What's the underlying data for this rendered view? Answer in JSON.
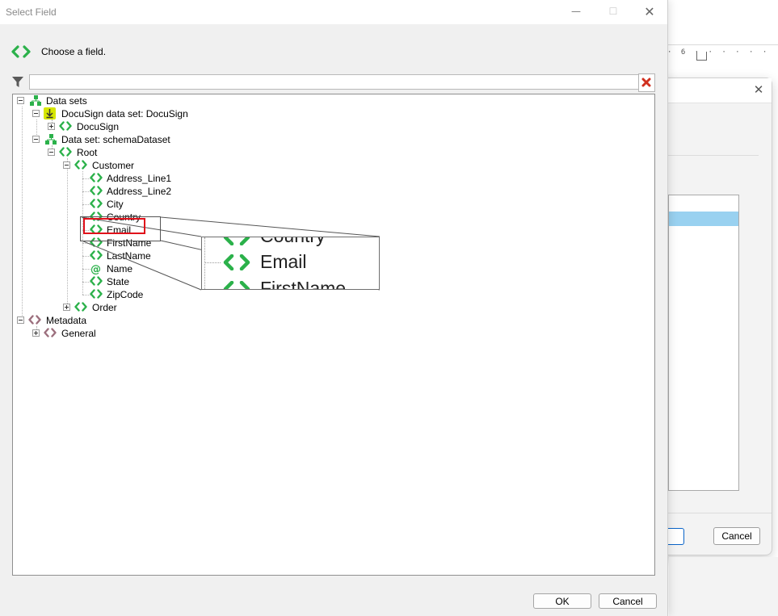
{
  "background": {
    "ruler_ticks": "· 6 ·  ·  ·  ·  ·  ·",
    "close_glyph": "✕",
    "cancel_label": "Cancel"
  },
  "dialog": {
    "title": "Select Field",
    "window_buttons": {
      "minimize": "—",
      "maximize": "☐",
      "close": "✕"
    },
    "prompt": "Choose a field.",
    "filter": {
      "value": "",
      "placeholder": ""
    },
    "ok_label": "OK",
    "cancel_label": "Cancel"
  },
  "tree": {
    "data_sets": "Data sets",
    "docusign_dataset": "DocuSign data set: DocuSign",
    "docusign": "DocuSign",
    "schema_dataset": "Data set: schemaDataset",
    "root": "Root",
    "customer": "Customer",
    "fields": [
      "Address_Line1",
      "Address_Line2",
      "City",
      "Country",
      "Email",
      "FirstName",
      "LastName",
      "Name",
      "State",
      "ZipCode"
    ],
    "order": "Order",
    "metadata": "Metadata",
    "general": "General"
  },
  "zoom": {
    "lines": [
      "Country",
      "Email",
      "FirstName"
    ]
  },
  "colors": {
    "field_icon": "#2bb14a",
    "metadata_icon": "#9c6f7d",
    "highlight": "#e0101a",
    "download_badge": "#d6e600"
  }
}
